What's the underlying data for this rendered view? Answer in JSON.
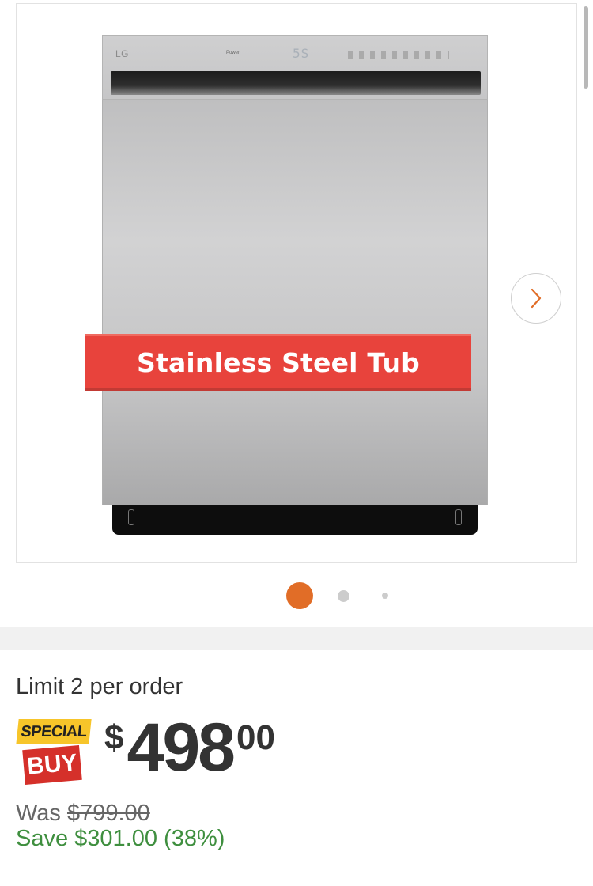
{
  "gallery": {
    "banner_text": "Stainless Steel Tub",
    "appliance": {
      "brand": "LG",
      "power_label": "Power",
      "display": "5S"
    },
    "next_icon": "chevron-right-icon",
    "dots": {
      "count": 3,
      "active": 1
    }
  },
  "pricing": {
    "limit_text": "Limit 2 per order",
    "badge": {
      "top": "SPECIAL",
      "bottom": "BUY"
    },
    "currency": "$",
    "dollars": "498",
    "cents": "00",
    "was_label": "Was ",
    "was_price": "$799.00",
    "save_text": "Save $301.00 (38%)"
  },
  "colors": {
    "accent": "#e16d27",
    "banner": "#e8433c",
    "save_green": "#3f8f3f",
    "badge_yellow": "#f7c52a",
    "badge_red": "#d5302a"
  }
}
